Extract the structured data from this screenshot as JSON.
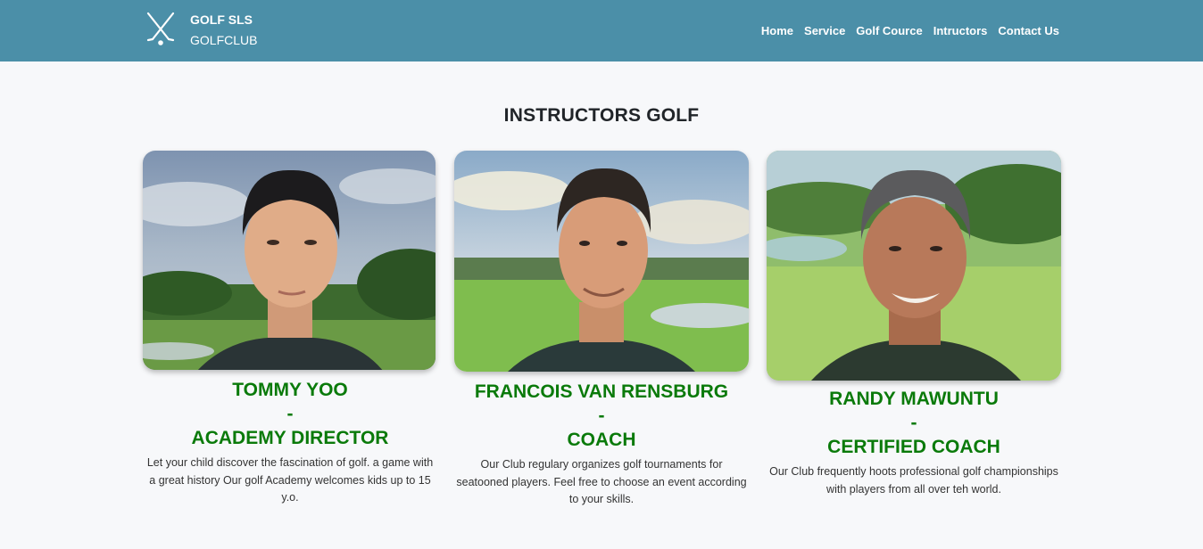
{
  "brand": {
    "title": "GOLF SLS",
    "subtitle": "GOLFCLUB",
    "logo_icon": "crossed-golf-clubs-icon"
  },
  "nav": {
    "items": [
      {
        "label": "Home"
      },
      {
        "label": "Service"
      },
      {
        "label": "Golf Cource"
      },
      {
        "label": "Intructors"
      },
      {
        "label": "Contact Us"
      }
    ]
  },
  "page": {
    "title": "INSTRUCTORS GOLF"
  },
  "instructors": [
    {
      "name": "TOMMY YOO",
      "separator": "-",
      "role": "ACADEMY DIRECTOR",
      "description": "Let your child discover the fascination of golf. a game with a great history Our golf Academy welcomes kids up to 15 y.o."
    },
    {
      "name": "FRANCOIS VAN RENSBURG",
      "separator": "-",
      "role": "COACH",
      "description": "Our Club regulary organizes golf tournaments for seatooned players. Feel free to choose an event according to your skills."
    },
    {
      "name": "RANDY MAWUNTU",
      "separator": "-",
      "role": "CERTIFIED COACH",
      "description": "Our Club frequently hoots professional golf championships with players from all over teh world."
    }
  ],
  "colors": {
    "navbar": "#4b8fa8",
    "name_green": "#0a7a0a",
    "background": "#f7f8fa"
  }
}
